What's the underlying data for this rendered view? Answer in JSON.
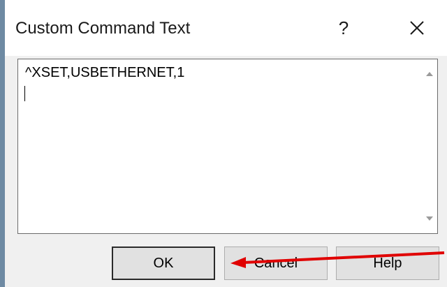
{
  "dialog": {
    "title": "Custom Command Text",
    "help_glyph": "?",
    "close_icon": "close-icon"
  },
  "editor": {
    "text": "^XSET,USBETHERNET,1"
  },
  "buttons": {
    "ok_label": "OK",
    "cancel_label": "Cancel",
    "help_label": "Help"
  },
  "annotation": {
    "arrow_color": "#e00000"
  }
}
